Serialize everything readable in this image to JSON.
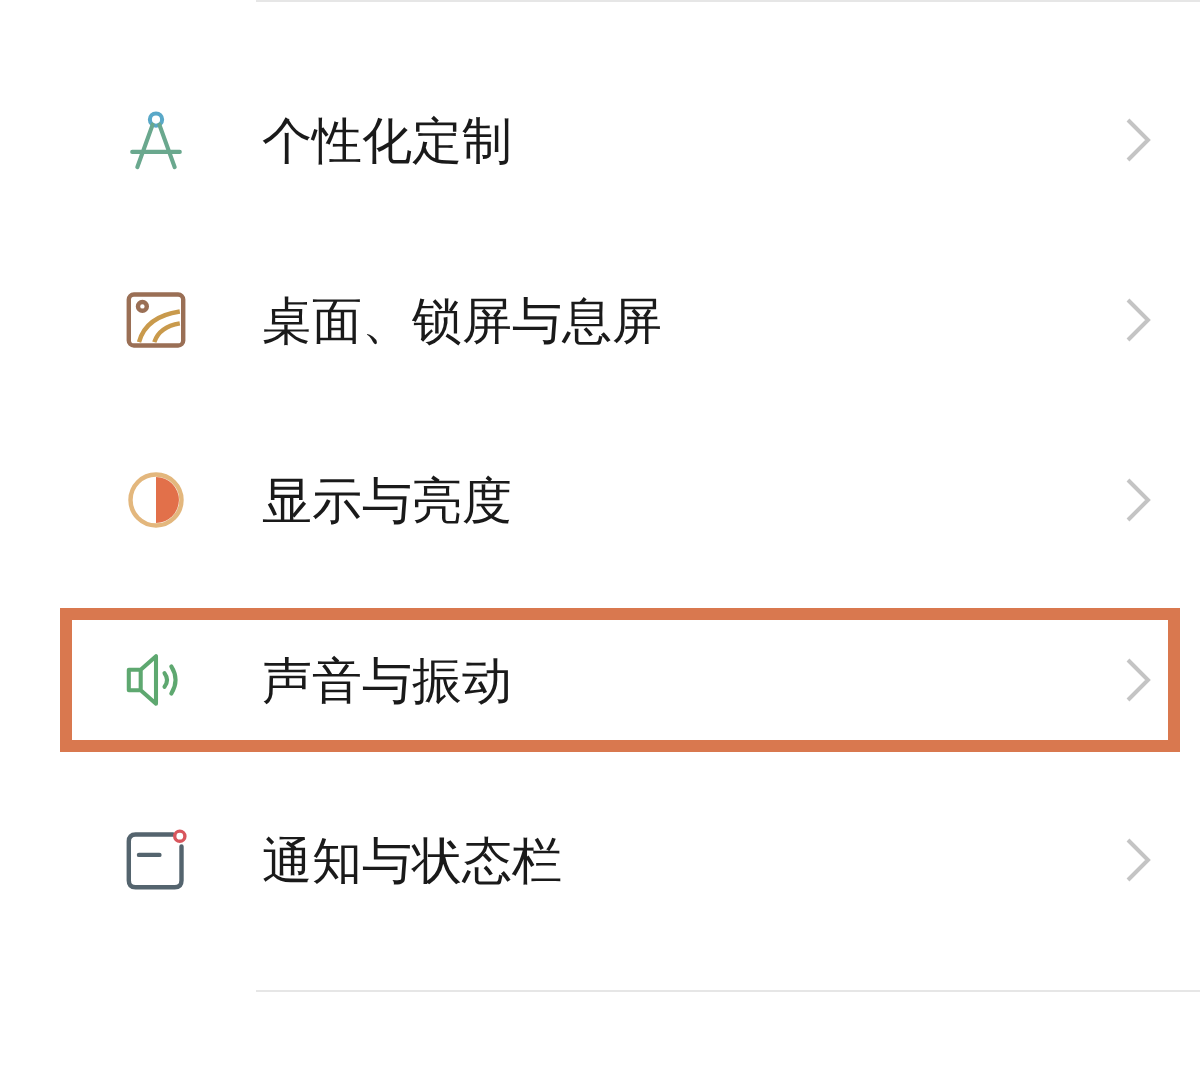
{
  "settings_items": [
    {
      "kind": "compass",
      "label": "个性化定制",
      "selected": false
    },
    {
      "kind": "wallpaper",
      "label": "桌面、锁屏与息屏",
      "selected": false
    },
    {
      "kind": "display",
      "label": "显示与亮度",
      "selected": false
    },
    {
      "kind": "sound",
      "label": "声音与振动",
      "selected": true
    },
    {
      "kind": "notification",
      "label": "通知与状态栏",
      "selected": false
    }
  ]
}
